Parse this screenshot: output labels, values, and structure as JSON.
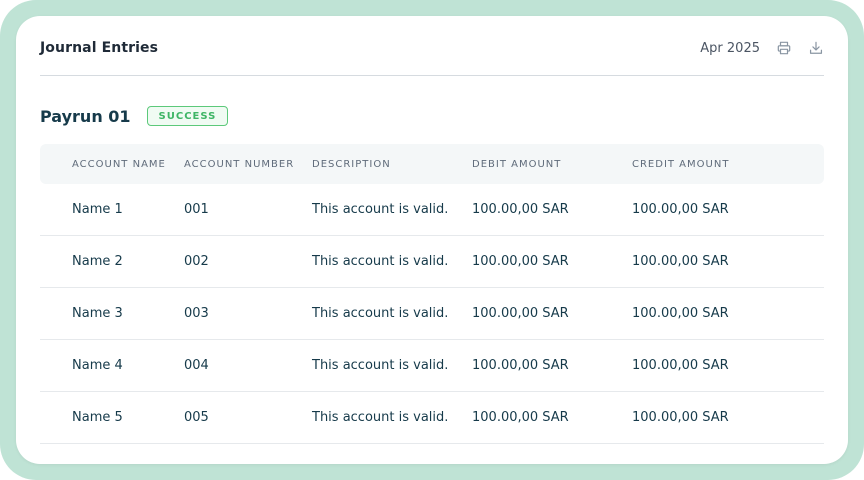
{
  "header": {
    "title": "Journal Entries",
    "date": "Apr 2025",
    "print_icon": "printer-icon",
    "download_icon": "download-icon"
  },
  "payrun": {
    "title": "Payrun 01",
    "status": "SUCCESS",
    "status_color": "#3fb566"
  },
  "table": {
    "columns": [
      "ACCOUNT NAME",
      "ACCOUNT NUMBER",
      "DESCRIPTION",
      "DEBIT AMOUNT",
      "CREDIT AMOUNT"
    ],
    "rows": [
      {
        "name": "Name 1",
        "number": "001",
        "description": "This account is valid.",
        "debit": "100.00,00 SAR",
        "credit": "100.00,00 SAR"
      },
      {
        "name": "Name 2",
        "number": "002",
        "description": "This account is valid.",
        "debit": "100.00,00 SAR",
        "credit": "100.00,00 SAR"
      },
      {
        "name": "Name 3",
        "number": "003",
        "description": "This account is valid.",
        "debit": "100.00,00 SAR",
        "credit": "100.00,00 SAR"
      },
      {
        "name": "Name 4",
        "number": "004",
        "description": "This account is valid.",
        "debit": "100.00,00 SAR",
        "credit": "100.00,00 SAR"
      },
      {
        "name": "Name 5",
        "number": "005",
        "description": "This account is valid.",
        "debit": "100.00,00 SAR",
        "credit": "100.00,00 SAR"
      }
    ]
  }
}
